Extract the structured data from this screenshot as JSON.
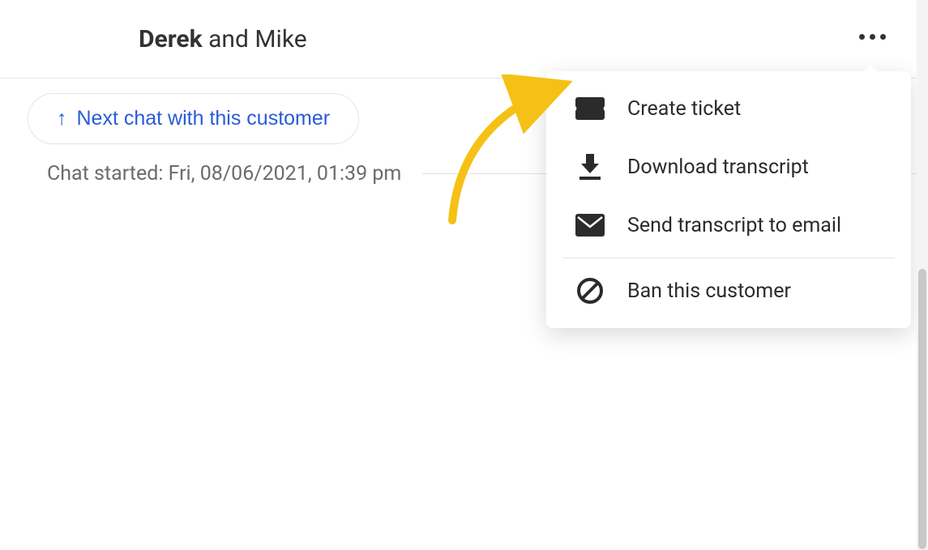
{
  "header": {
    "participant_primary": "Derek",
    "connector": " and ",
    "participant_secondary": "Mike"
  },
  "next_chat_button": {
    "label": "Next chat with this customer"
  },
  "chat_started_label": "Chat started: Fri, 08/06/2021, 01:39 pm",
  "menu": {
    "create_ticket": "Create ticket",
    "download_transcript": "Download transcript",
    "send_transcript_email": "Send transcript to email",
    "ban_customer": "Ban this customer"
  },
  "annotation": {
    "arrow_color": "#f5c116"
  }
}
